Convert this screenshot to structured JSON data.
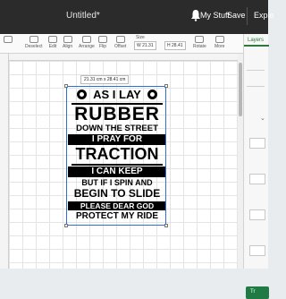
{
  "titlebar": {
    "document_name": "Untitled*",
    "my_stuff": "My Stuff",
    "save": "Save",
    "explore": "Exple"
  },
  "toolbar": {
    "deselect": "Deselect",
    "edit": "Edit",
    "align": "Align",
    "arrange": "Arrange",
    "flip": "Flip",
    "offset": "Offset",
    "size": "Size",
    "rotate": "Rotate",
    "more": "More",
    "width": "W 21.31",
    "height": "H 28.41"
  },
  "layers_panel": {
    "tab": "Layers",
    "make_it": "Tr"
  },
  "selection": {
    "dimensions": "21.31 cm x 28.41 cm"
  },
  "design": {
    "lines": [
      "AS I LAY",
      "RUBBER",
      "DOWN THE STREET",
      "I PRAY FOR",
      "TRACTION",
      "I CAN KEEP",
      "BUT IF I SPIN AND",
      "BEGIN TO SLIDE",
      "PLEASE DEAR GOD",
      "PROTECT MY RIDE"
    ]
  }
}
